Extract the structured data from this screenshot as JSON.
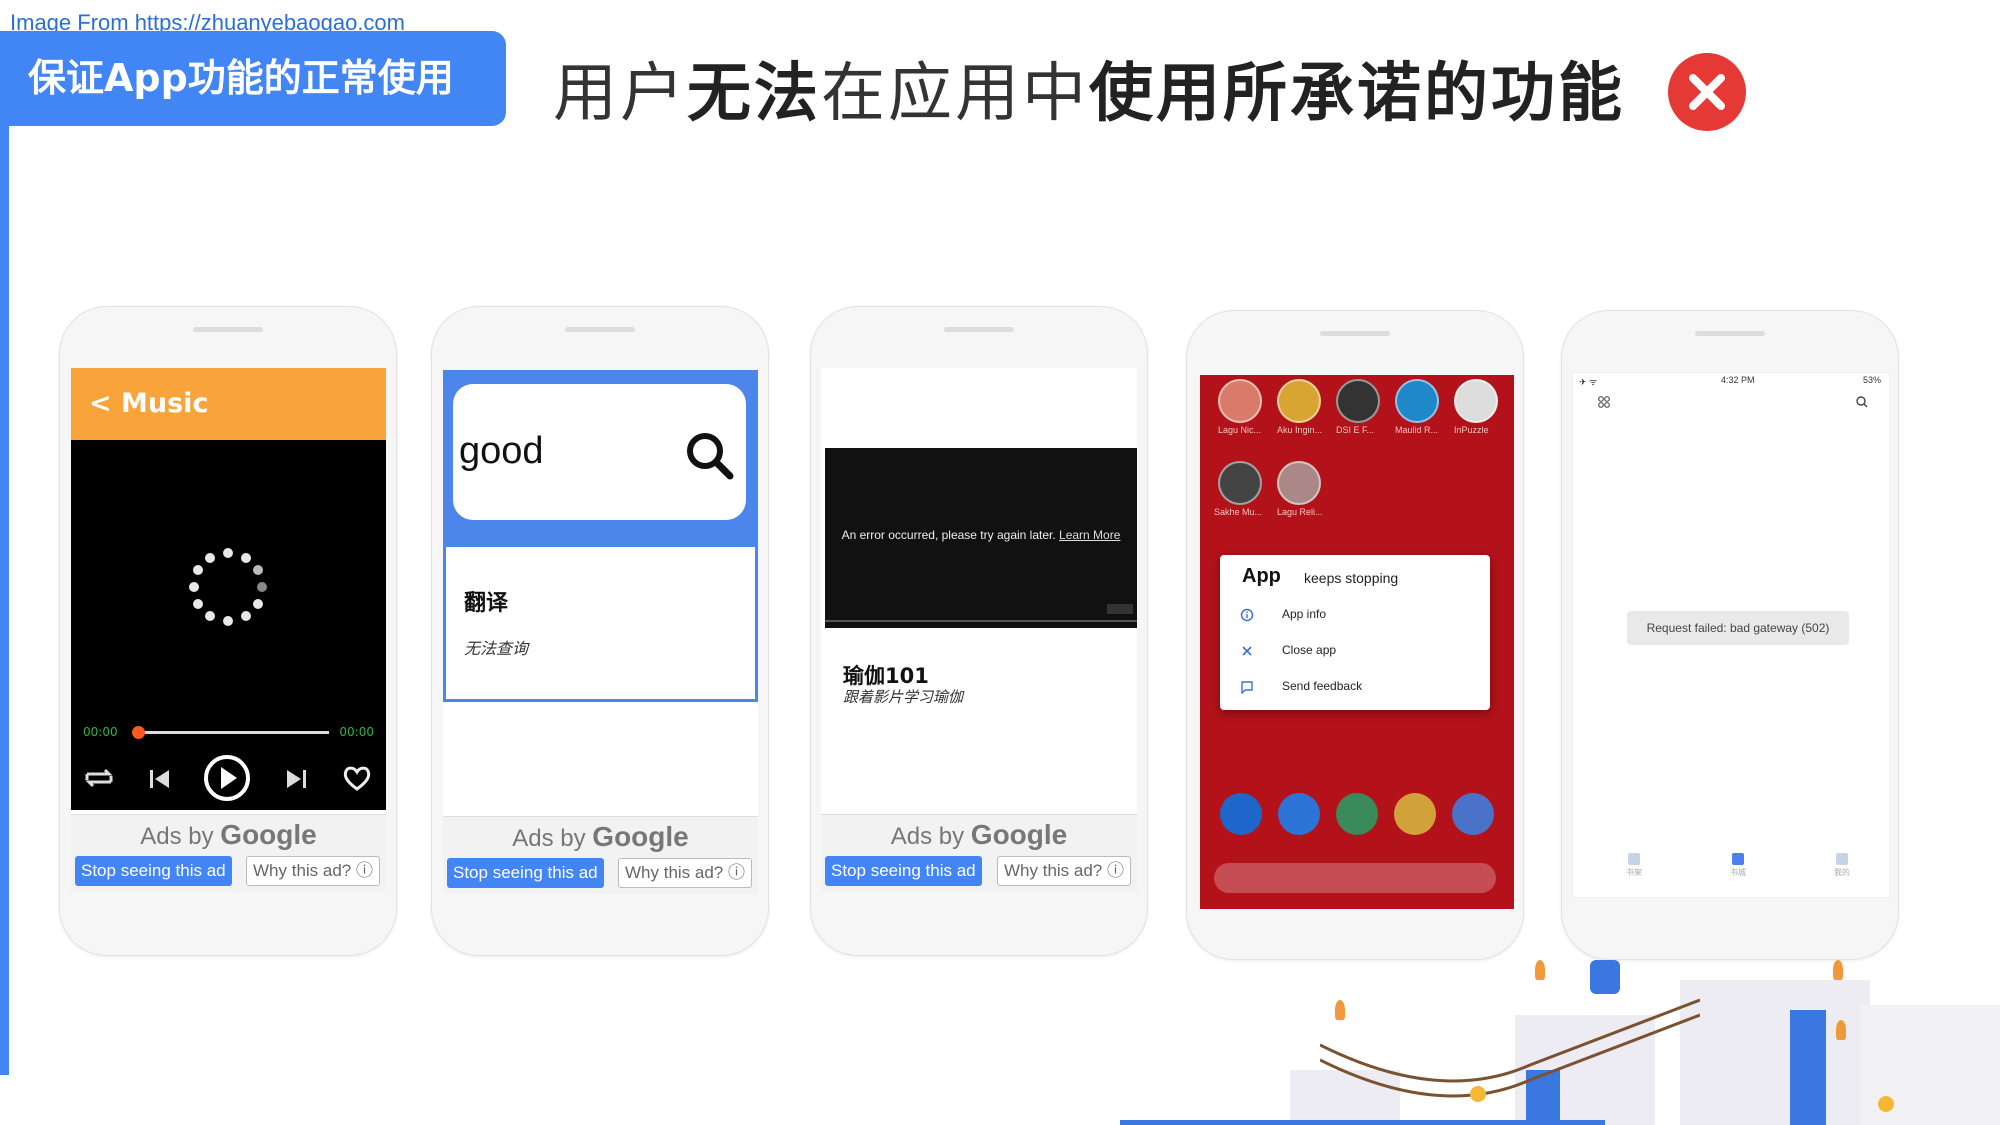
{
  "source_note": "Image From https://zhuanyebaogao.com",
  "badge": "保证App功能的正常使用",
  "headline": {
    "part1": "用户",
    "part2": "无法",
    "part3": "在应用中",
    "part4": "使用所承诺的功能"
  },
  "status_icon": "close-x-icon",
  "colors": {
    "accent": "#4285f4",
    "error": "#e53935",
    "music_header": "#f9a43a",
    "android_bg": "#b3121a"
  },
  "ads": {
    "label_prefix": "Ads by",
    "label_brand": "Google",
    "stop_label": "Stop seeing this ad",
    "why_label": "Why this ad? ⓘ"
  },
  "phone1": {
    "header": "<  Music",
    "time_start": "00:00",
    "time_end": "00:00",
    "progress": 0.02
  },
  "phone2": {
    "search_value": "good",
    "card_title": "翻译",
    "card_subtitle": "无法查询"
  },
  "phone3": {
    "video_error": "An error occurred, please try again later.",
    "learn_more": "Learn More",
    "title": "瑜伽101",
    "subtitle": "跟着影片学习瑜伽"
  },
  "phone4": {
    "app_labels": [
      "Lagu Nic...",
      "Aku Ingin...",
      "DSI E F...",
      "Maulid R...",
      "InPuzzle",
      "Sakhe Mu...",
      "Lagu Reli..."
    ],
    "dialog_title": "App",
    "dialog_subtitle": "keeps stopping",
    "options": [
      "App info",
      "Close app",
      "Send feedback"
    ]
  },
  "phone5": {
    "status_time": "4:32 PM",
    "status_battery": "53%",
    "toast": "Request failed: bad gateway (502)",
    "nav": [
      "书架",
      "书城",
      "我的"
    ]
  }
}
